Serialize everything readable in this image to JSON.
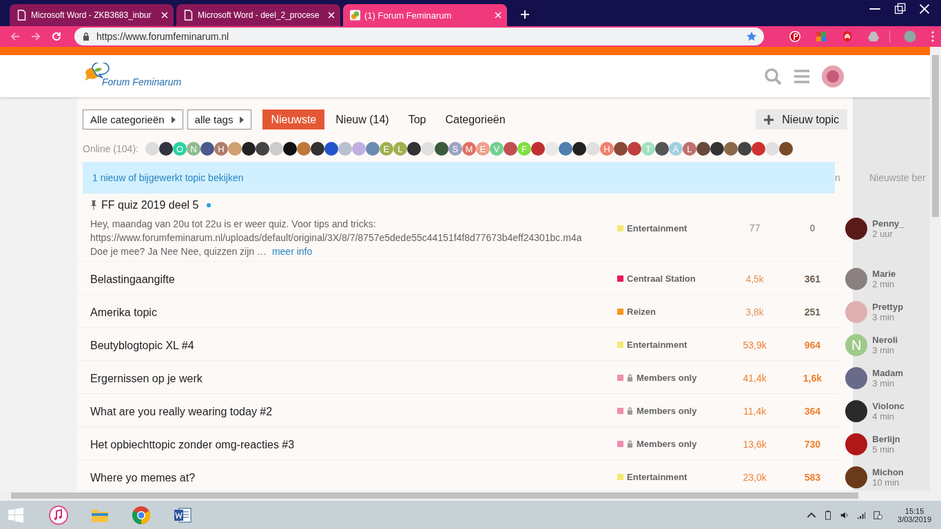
{
  "browser": {
    "tabs": [
      {
        "title": "Microsoft Word - ZKB3683_inbur",
        "kind": "doc",
        "selected": false
      },
      {
        "title": "Microsoft Word - deel_2_procese",
        "kind": "doc",
        "selected": false
      },
      {
        "title": "(1) Forum Feminarum",
        "kind": "site",
        "selected": true
      }
    ],
    "url": "https://www.forumfeminarum.nl"
  },
  "site": {
    "logo_text": "Forum Feminarum"
  },
  "filters": [
    {
      "label": "Alle categorieën"
    },
    {
      "label": "alle tags"
    }
  ],
  "nav": [
    {
      "label": "Nieuwste",
      "selected": true
    },
    {
      "label": "Nieuw (14)",
      "selected": false
    },
    {
      "label": "Top",
      "selected": false
    },
    {
      "label": "Categorieën",
      "selected": false
    }
  ],
  "new_topic": "Nieuw topic",
  "online": {
    "label": "Online (104):",
    "avatars": [
      {
        "color": "#dddddd"
      },
      {
        "color": "#333344"
      },
      {
        "color": "#2bd1a0",
        "letter": "O"
      },
      {
        "color": "#8fbc8f",
        "letter": "N"
      },
      {
        "color": "#4a5a8a"
      },
      {
        "color": "#b07b6a",
        "letter": "H"
      },
      {
        "color": "#d0a070"
      },
      {
        "color": "#222222"
      },
      {
        "color": "#444444"
      },
      {
        "color": "#cccccc"
      },
      {
        "color": "#111111"
      },
      {
        "color": "#c0783a"
      },
      {
        "color": "#333333"
      },
      {
        "color": "#2255cc"
      },
      {
        "color": "#b8c0d0"
      },
      {
        "color": "#c0b0e0"
      },
      {
        "color": "#6a8ab0"
      },
      {
        "color": "#a0b050",
        "letter": "E"
      },
      {
        "color": "#a0b050",
        "letter": "L"
      },
      {
        "color": "#333333"
      },
      {
        "color": "#e0e0e0"
      },
      {
        "color": "#3a5a3a"
      },
      {
        "color": "#9aa3c0",
        "letter": "S"
      },
      {
        "color": "#e07060",
        "letter": "M"
      },
      {
        "color": "#f0a090",
        "letter": "E"
      },
      {
        "color": "#70d090",
        "letter": "V"
      },
      {
        "color": "#c05050"
      },
      {
        "color": "#80e040",
        "letter": "F"
      },
      {
        "color": "#c03030"
      },
      {
        "color": "#e8e8e8"
      },
      {
        "color": "#5080b0"
      },
      {
        "color": "#222222"
      },
      {
        "color": "#e0e0e0"
      },
      {
        "color": "#f08070",
        "letter": "H"
      },
      {
        "color": "#8a4a3a"
      },
      {
        "color": "#c04040"
      },
      {
        "color": "#a0e0c0",
        "letter": "T"
      },
      {
        "color": "#555555"
      },
      {
        "color": "#a0d0e0",
        "letter": "A"
      },
      {
        "color": "#c07070",
        "letter": "L"
      },
      {
        "color": "#6a4a3a"
      },
      {
        "color": "#333333"
      },
      {
        "color": "#8a6a4a"
      },
      {
        "color": "#444444"
      },
      {
        "color": "#d03030"
      },
      {
        "color": "#e0e0e0"
      },
      {
        "color": "#7a4a2a"
      }
    ]
  },
  "banner": "1 nieuw of bijgewerkt topic bekijken",
  "column_4": "n",
  "column_5": "Nieuwste ber",
  "topics": [
    {
      "title": "FF quiz 2019 deel 5",
      "pinned": true,
      "unread": true,
      "excerpt": [
        "Hey, maandag van 20u tot 22u is er weer quiz. Voor tips and tricks:",
        "https://www.forumfeminarum.nl/uploads/default/original/3X/8/7/8757e5dede55c44151f4f8d77673b4eff24301bc.m4a",
        "Doe je mee? Ja Nee Nee, quizzen zijn …"
      ],
      "more": "meer info",
      "category": {
        "name": "Entertainment",
        "color": "#f7e86f",
        "locked": false
      },
      "views": {
        "text": "77",
        "color": "#8f8f8f"
      },
      "replies": {
        "text": "0",
        "color": "#8f8f8f"
      },
      "last": {
        "name": "Penny_",
        "time": "2 uur",
        "color": "#5a1a1a"
      }
    },
    {
      "title": "Belastingaangifte",
      "pinned": false,
      "unread": false,
      "category": {
        "name": "Centraal Station",
        "color": "#e8175d",
        "locked": false
      },
      "views": {
        "text": "4,5k",
        "color": "#e3915a"
      },
      "replies": {
        "text": "361",
        "color": "#6f5f4f"
      },
      "last": {
        "name": "Marie",
        "time": "2 min",
        "color": "#8a8080"
      }
    },
    {
      "title": "Amerika topic",
      "pinned": false,
      "unread": false,
      "category": {
        "name": "Reizen",
        "color": "#f7941d",
        "locked": false
      },
      "views": {
        "text": "3,8k",
        "color": "#e3915a"
      },
      "replies": {
        "text": "251",
        "color": "#6f5f4f"
      },
      "last": {
        "name": "Prettyp",
        "time": "3 min",
        "color": "#e0b0b0"
      }
    },
    {
      "title": "Beutyblogtopic XL #4",
      "pinned": false,
      "unread": false,
      "category": {
        "name": "Entertainment",
        "color": "#f7e86f",
        "locked": false
      },
      "views": {
        "text": "53,9k",
        "color": "#f0802e"
      },
      "replies": {
        "text": "964",
        "color": "#ef7f2c"
      },
      "last": {
        "name": "Neroli",
        "time": "3 min",
        "color": "#9fc98a",
        "letter": "N"
      }
    },
    {
      "title": "Ergernissen op je werk",
      "pinned": false,
      "unread": false,
      "category": {
        "name": "Members only",
        "color": "#f08cb0",
        "locked": true
      },
      "views": {
        "text": "41,4k",
        "color": "#f0802e"
      },
      "replies": {
        "text": "1,6k",
        "color": "#ef7f2c"
      },
      "last": {
        "name": "Madam",
        "time": "3 min",
        "color": "#6a6a8a"
      }
    },
    {
      "title": "What are you really wearing today #2",
      "pinned": false,
      "unread": false,
      "category": {
        "name": "Members only",
        "color": "#f08cb0",
        "locked": true
      },
      "views": {
        "text": "11,4k",
        "color": "#f0802e"
      },
      "replies": {
        "text": "364",
        "color": "#ef7f2c"
      },
      "last": {
        "name": "Violonc",
        "time": "4 min",
        "color": "#2a2a2a"
      }
    },
    {
      "title": "Het opbiechttopic zonder omg-reacties #3",
      "pinned": false,
      "unread": false,
      "category": {
        "name": "Members only",
        "color": "#f08cb0",
        "locked": true
      },
      "views": {
        "text": "13,6k",
        "color": "#f0802e"
      },
      "replies": {
        "text": "730",
        "color": "#ef7f2c"
      },
      "last": {
        "name": "Berlijn",
        "time": "5 min",
        "color": "#b01818"
      }
    },
    {
      "title": "Where yo memes at?",
      "pinned": false,
      "unread": false,
      "category": {
        "name": "Entertainment",
        "color": "#f7e86f",
        "locked": false
      },
      "views": {
        "text": "23,0k",
        "color": "#f0802e"
      },
      "replies": {
        "text": "583",
        "color": "#ef7f2c"
      },
      "last": {
        "name": "Michon",
        "time": "10 min",
        "color": "#6a3a1a"
      }
    }
  ],
  "taskbar": {
    "apps": [
      {
        "kind": "itunes"
      },
      {
        "kind": "explorer"
      },
      {
        "kind": "chrome"
      },
      {
        "kind": "word"
      }
    ],
    "time": "15:15",
    "date": "3/03/2019"
  }
}
